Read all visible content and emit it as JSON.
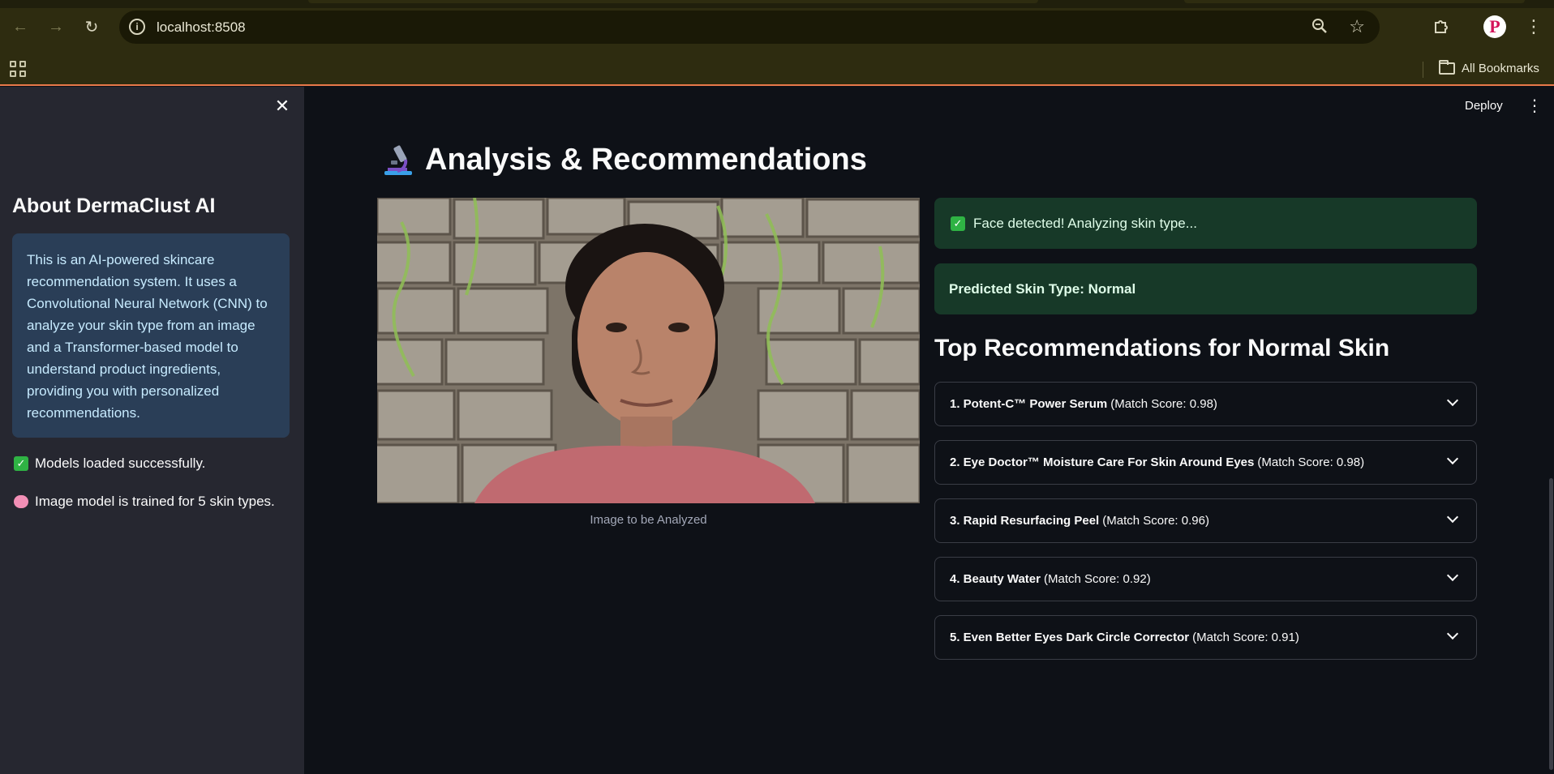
{
  "browser": {
    "url": "localhost:8508",
    "bookmarks_label": "All Bookmarks",
    "profile_initial": "P",
    "icons": [
      "back-icon",
      "forward-icon",
      "reload-icon",
      "info-icon",
      "zoom-icon",
      "star-icon",
      "extensions-icon",
      "menu-icon",
      "apps-icon",
      "folder-icon"
    ]
  },
  "app": {
    "deploy_label": "Deploy"
  },
  "sidebar": {
    "title": "About DermaClust AI",
    "info_text": "This is an AI-powered skincare recommendation system. It uses a Convolutional Neural Network (CNN) to analyze your skin type from an image and a Transformer-based model to understand product ingredients, providing you with personalized recommendations.",
    "status_models": "Models loaded successfully.",
    "status_trained": "Image model is trained for 5 skin types."
  },
  "main": {
    "title": "Analysis & Recommendations",
    "image_caption": "Image to be Analyzed",
    "face_detected": "Face detected! Analyzing skin type...",
    "predicted": "Predicted Skin Type: Normal",
    "rec_heading": "Top Recommendations for Normal Skin",
    "recommendations": [
      {
        "name": "1. Potent-C™ Power Serum",
        "score": "(Match Score: 0.98)"
      },
      {
        "name": "2. Eye Doctor™ Moisture Care For Skin Around Eyes",
        "score": "(Match Score: 0.98)"
      },
      {
        "name": "3. Rapid Resurfacing Peel",
        "score": "(Match Score: 0.96)"
      },
      {
        "name": "4. Beauty Water",
        "score": "(Match Score: 0.92)"
      },
      {
        "name": "5. Even Better Eyes Dark Circle Corrector",
        "score": "(Match Score: 0.91)"
      }
    ]
  },
  "colors": {
    "app_bg": "#0e1117",
    "sidebar_bg": "#262730",
    "success_bg": "#173928",
    "info_bg": "#1c3a5e",
    "browser_chrome": "#2e2c10"
  }
}
